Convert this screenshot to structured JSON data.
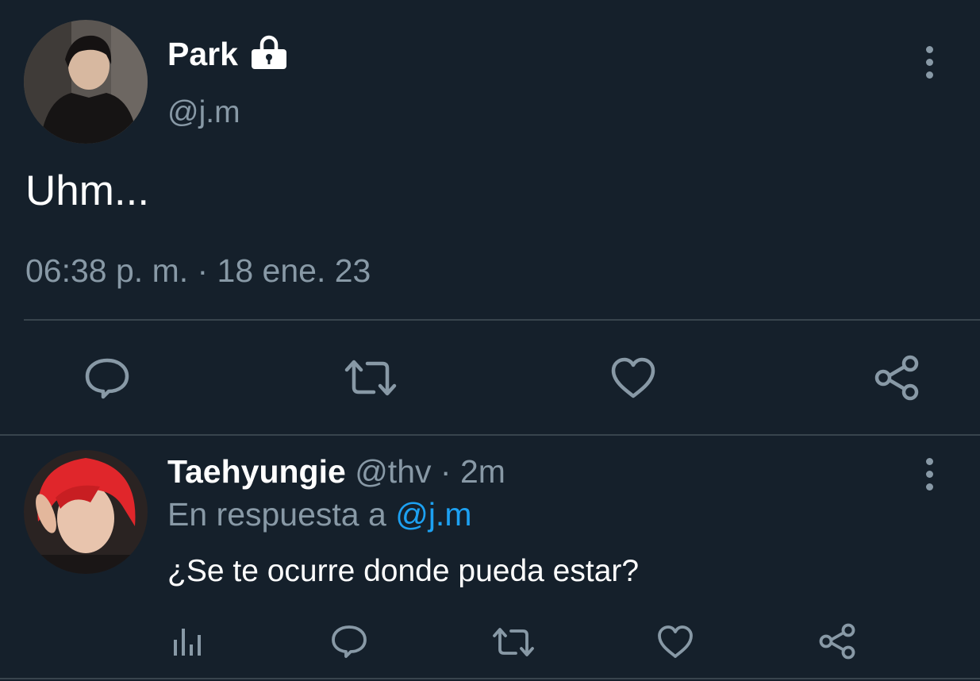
{
  "main_tweet": {
    "display_name": "Park",
    "handle": "@j.m",
    "text": "Uhm...",
    "timestamp": "06:38 p. m. · 18 ene. 23",
    "protected_icon": "lock-icon",
    "actions": [
      "reply-icon",
      "retweet-icon",
      "like-icon",
      "share-icon"
    ]
  },
  "reply_tweet": {
    "display_name": "Taehyungie",
    "handle": "@thv",
    "time_sep": "·",
    "time": "2m",
    "reply_prefix": "En respuesta a",
    "reply_to": "@j.m",
    "text": "¿Se te ocurre donde pueda estar?",
    "actions": [
      "analytics-icon",
      "reply-icon",
      "retweet-icon",
      "like-icon",
      "share-icon"
    ]
  },
  "colors": {
    "background": "#15202b",
    "text": "#ffffff",
    "muted": "#8899a6",
    "link": "#1da1f2",
    "divider": "#38444d",
    "reply_avatar_hair": "#e0262b"
  }
}
